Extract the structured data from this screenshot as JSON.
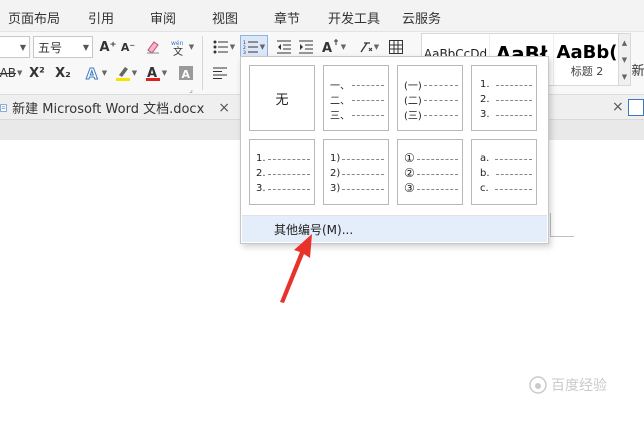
{
  "menu": {
    "items": [
      "页面布局",
      "引用",
      "审阅",
      "视图",
      "章节",
      "开发工具",
      "云服务"
    ]
  },
  "ribbon": {
    "font_size_value": "五号",
    "grow_font": "A⁺",
    "shrink_font": "A⁻",
    "superscript": "X²",
    "subscript": "X₂",
    "styles": [
      {
        "preview": "AaBbCcDd",
        "name": ""
      },
      {
        "preview": "AaBł",
        "name": ""
      },
      {
        "preview": "AaBb(",
        "name": "标题 2"
      }
    ],
    "new_style_partial": "新"
  },
  "tabs": {
    "document_title": "新建 Microsoft Word 文档.docx",
    "close_glyph": "×"
  },
  "numbering_panel": {
    "none_label": "无",
    "row1": [
      {
        "markers": [
          "一、",
          "二、",
          "三、"
        ]
      },
      {
        "markers": [
          "(一)",
          "(二)",
          "(三)"
        ]
      },
      {
        "markers": [
          "1.",
          "2.",
          "3."
        ]
      }
    ],
    "row2": [
      {
        "markers": [
          "1.",
          "2.",
          "3."
        ]
      },
      {
        "markers": [
          "1)",
          "2)",
          "3)"
        ]
      },
      {
        "markers": [
          "①",
          "②",
          "③"
        ]
      },
      {
        "markers": [
          "a.",
          "b.",
          "c."
        ]
      }
    ],
    "more_label": "其他编号(M)..."
  },
  "colors": {
    "annotation_arrow": "#e8322a",
    "highlight_hover": "#e4edfa",
    "font_color_bar": "#e02020",
    "highlighter_bar": "#f5e400"
  },
  "watermark": "百度经验"
}
